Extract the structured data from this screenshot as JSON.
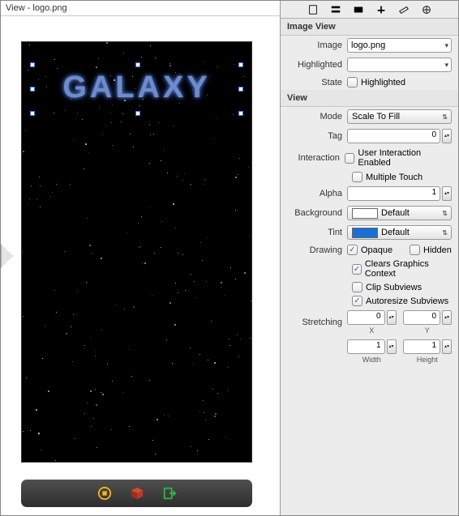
{
  "canvas": {
    "title": "View - logo.png",
    "artwork_text": "GALAXY"
  },
  "imageview": {
    "header": "Image View",
    "image_lbl": "Image",
    "image_val": "logo.png",
    "highlighted_lbl": "Highlighted",
    "highlighted_val": "",
    "state_lbl": "State",
    "state_cb_lbl": "Highlighted",
    "state_checked": false
  },
  "view": {
    "header": "View",
    "mode_lbl": "Mode",
    "mode_val": "Scale To Fill",
    "tag_lbl": "Tag",
    "tag_val": "0",
    "interaction_lbl": "Interaction",
    "uie_lbl": "User Interaction Enabled",
    "uie_checked": false,
    "mt_lbl": "Multiple Touch",
    "mt_checked": false,
    "alpha_lbl": "Alpha",
    "alpha_val": "1",
    "bg_lbl": "Background",
    "bg_val": "Default",
    "bg_color": "#ffffff",
    "tint_lbl": "Tint",
    "tint_val": "Default",
    "tint_color": "#1a6fd6",
    "drawing_lbl": "Drawing",
    "opaque_lbl": "Opaque",
    "opaque_checked": true,
    "hidden_lbl": "Hidden",
    "hidden_checked": false,
    "cgc_lbl": "Clears Graphics Context",
    "cgc_checked": true,
    "clip_lbl": "Clip Subviews",
    "clip_checked": false,
    "auto_lbl": "Autoresize Subviews",
    "auto_checked": true,
    "stretch_lbl": "Stretching",
    "x_val": "0",
    "x_lbl": "X",
    "y_val": "0",
    "y_lbl": "Y",
    "w_val": "1",
    "w_lbl": "Width",
    "h_val": "1",
    "h_lbl": "Height"
  }
}
